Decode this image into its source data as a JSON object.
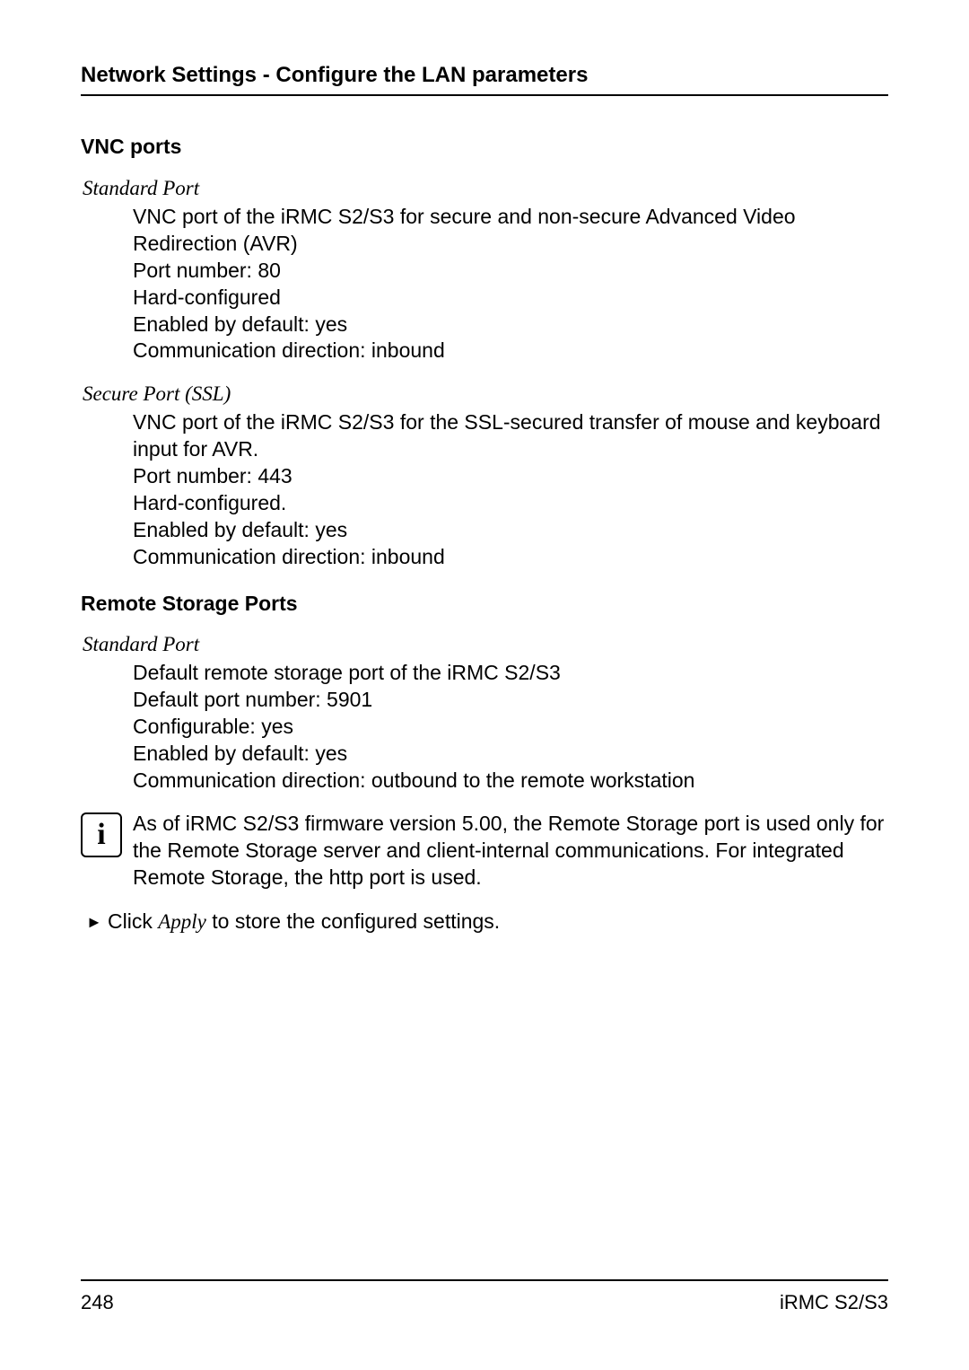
{
  "header": {
    "breadcrumb": "Network Settings - Configure the LAN parameters"
  },
  "vnc": {
    "title": "VNC ports",
    "standard": {
      "term": "Standard Port",
      "line1": "VNC port of the iRMC S2/S3 for secure and non-secure Advanced Video Redirection (AVR)",
      "line2": "Port number: 80",
      "line3": "Hard-configured",
      "line4": "Enabled by default: yes",
      "line5": "Communication direction: inbound"
    },
    "secure": {
      "term": "Secure Port (SSL)",
      "line1": "VNC port of the iRMC S2/S3 for the SSL-secured transfer of mouse and keyboard input for AVR.",
      "line2": "Port number: 443",
      "line3": "Hard-configured.",
      "line4": "Enabled by default: yes",
      "line5": "Communication direction: inbound"
    }
  },
  "remote": {
    "title": "Remote Storage Ports",
    "standard": {
      "term": "Standard Port",
      "line1": "Default remote storage port of the iRMC S2/S3",
      "line2": "Default port number: 5901",
      "line3": "Configurable: yes",
      "line4": "Enabled by default: yes",
      "line5": "Communication direction: outbound to the remote workstation"
    }
  },
  "note": {
    "icon": "i",
    "text": "As of iRMC S2/S3 firmware version 5.00, the Remote Storage port is used only for the Remote Storage server and client-internal communications. For integrated Remote Storage, the http port is used."
  },
  "action": {
    "bullet": "►",
    "prefix": "Click ",
    "apply": "Apply",
    "suffix": " to store the configured settings."
  },
  "footer": {
    "page": "248",
    "doc": "iRMC S2/S3"
  }
}
